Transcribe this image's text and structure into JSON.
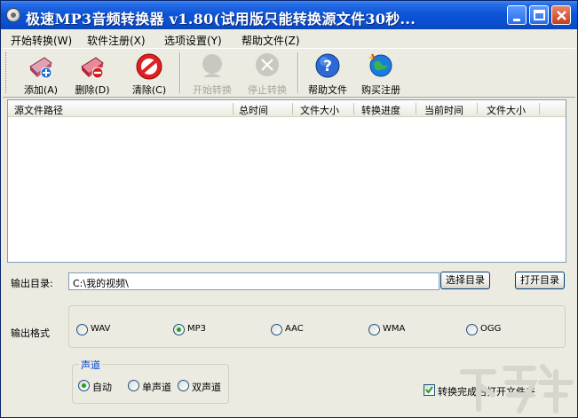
{
  "window": {
    "title": "极速MP3音频转换器 v1.80(试用版只能转换源文件30秒..."
  },
  "menu": [
    "开始转换(W)",
    "软件注册(X)",
    "选项设置(Y)",
    "帮助文件(Z)"
  ],
  "toolbar": {
    "add": "添加(A)",
    "delete": "删除(D)",
    "clear": "清除(C)",
    "start": "开始转换",
    "stop": "停止转换",
    "help": "帮助文件",
    "buy": "购买注册"
  },
  "list": {
    "columns": [
      "源文件路径",
      "总时间",
      "文件大小",
      "转换进度",
      "当前时间",
      "文件大小"
    ],
    "rows": []
  },
  "output": {
    "label": "输出目录:",
    "value": "C:\\我的视频\\",
    "choose_button": "选择目录",
    "open_button": "打开目录"
  },
  "format": {
    "label": "输出格式",
    "options": [
      "WAV",
      "MP3",
      "AAC",
      "WMA",
      "OGG"
    ],
    "selected": "MP3"
  },
  "channel": {
    "legend": "声道",
    "options": [
      "自动",
      "单声道",
      "双声道"
    ],
    "selected": "自动"
  },
  "open_folder_checkbox": {
    "label": "转换完成后打开文件夹",
    "checked": true
  },
  "colors": {
    "title_bar": "#0b55d8",
    "accent": "#0046d5",
    "selected_radio": "#21a121"
  }
}
